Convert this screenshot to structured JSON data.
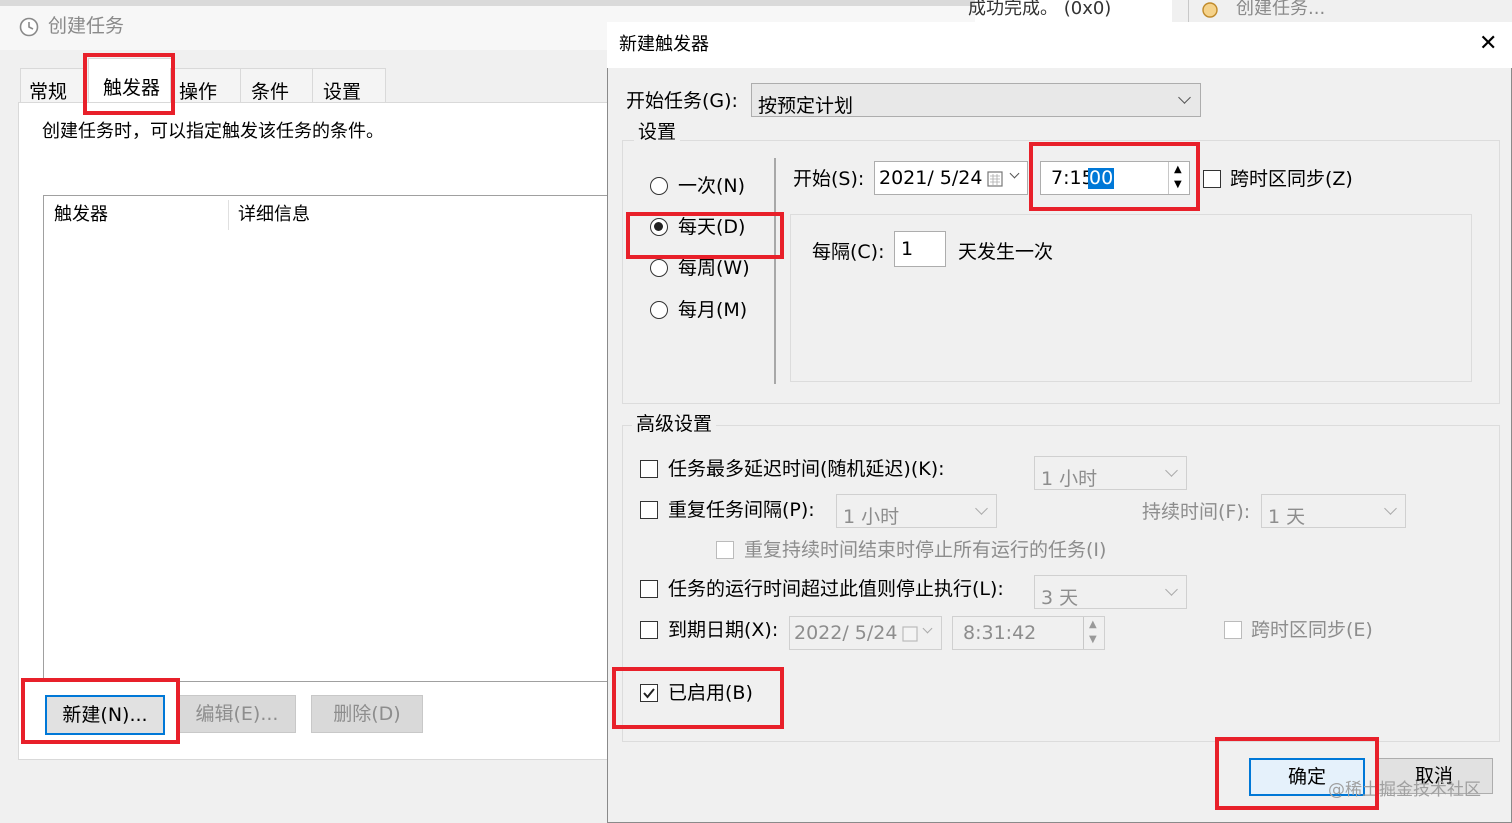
{
  "background_window": {
    "title": "创建任务",
    "top_fragment": "成功完成。 (0x0)",
    "right_fragment": "创建任务...",
    "tabs": [
      "常规",
      "触发器",
      "操作",
      "条件",
      "设置"
    ],
    "description": "创建任务时，可以指定触发该任务的条件。",
    "list_headers": [
      "触发器",
      "详细信息"
    ],
    "buttons": {
      "new": "新建(N)...",
      "edit": "编辑(E)...",
      "delete": "删除(D)"
    }
  },
  "dialog": {
    "title": "新建触发器",
    "close_glyph": "✕",
    "begin_task_label": "开始任务(G):",
    "begin_task_value": "按预定计划",
    "settings_group": "设置",
    "schedule_options": [
      "一次(N)",
      "每天(D)",
      "每周(W)",
      "每月(M)"
    ],
    "selected_schedule": "每天(D)",
    "start_label": "开始(S):",
    "start_date": "2021/ 5/24",
    "start_time_prefix": "7:15:",
    "start_time_selected": "00",
    "sync_timezone_label": "跨时区同步(Z)",
    "interval_label": "每隔(C):",
    "interval_value": "1",
    "interval_suffix": "天发生一次",
    "advanced_group": "高级设置",
    "max_delay_label": "任务最多延迟时间(随机延迟)(K):",
    "max_delay_value": "1 小时",
    "repeat_label": "重复任务间隔(P):",
    "repeat_value": "1 小时",
    "duration_label": "持续时间(F):",
    "duration_value": "1 天",
    "stop_running_label": "重复持续时间结束时停止所有运行的任务(I)",
    "stop_if_longer_label": "任务的运行时间超过此值则停止执行(L):",
    "stop_if_longer_value": "3 天",
    "expire_label": "到期日期(X):",
    "expire_date": "2022/ 5/24",
    "expire_time": "8:31:42",
    "expire_sync_label": "跨时区同步(E)",
    "enabled_label": "已启用(B)",
    "ok_button": "确定",
    "cancel_button": "取消"
  },
  "watermark": "@稀土掘金技术社区",
  "colors": {
    "highlight": "#e8202a",
    "selection": "#0078d7"
  }
}
